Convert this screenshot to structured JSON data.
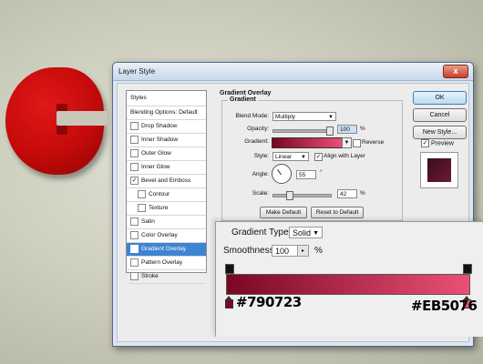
{
  "window": {
    "title": "Layer Style",
    "close_symbol": "x"
  },
  "styles_list": {
    "header": "Styles",
    "items": [
      {
        "label": "Blending Options: Default",
        "checkbox": false,
        "checked": false,
        "indent": false,
        "selected": false
      },
      {
        "label": "Drop Shadow",
        "checkbox": true,
        "checked": false,
        "indent": false,
        "selected": false
      },
      {
        "label": "Inner Shadow",
        "checkbox": true,
        "checked": false,
        "indent": false,
        "selected": false
      },
      {
        "label": "Outer Glow",
        "checkbox": true,
        "checked": false,
        "indent": false,
        "selected": false
      },
      {
        "label": "Inner Glow",
        "checkbox": true,
        "checked": false,
        "indent": false,
        "selected": false
      },
      {
        "label": "Bevel and Emboss",
        "checkbox": true,
        "checked": true,
        "indent": false,
        "selected": false
      },
      {
        "label": "Contour",
        "checkbox": true,
        "checked": false,
        "indent": true,
        "selected": false
      },
      {
        "label": "Texture",
        "checkbox": true,
        "checked": false,
        "indent": true,
        "selected": false
      },
      {
        "label": "Satin",
        "checkbox": true,
        "checked": false,
        "indent": false,
        "selected": false
      },
      {
        "label": "Color Overlay",
        "checkbox": true,
        "checked": false,
        "indent": false,
        "selected": false
      },
      {
        "label": "Gradient Overlay",
        "checkbox": true,
        "checked": true,
        "indent": false,
        "selected": true
      },
      {
        "label": "Pattern Overlay",
        "checkbox": true,
        "checked": false,
        "indent": false,
        "selected": false
      },
      {
        "label": "Stroke",
        "checkbox": true,
        "checked": false,
        "indent": false,
        "selected": false
      }
    ]
  },
  "buttons": {
    "ok": "OK",
    "cancel": "Cancel",
    "new_style": "New Style...",
    "preview": "Preview",
    "preview_checked": true
  },
  "gradient_overlay": {
    "panel_title": "Gradient Overlay",
    "group_title": "Gradient",
    "blend_mode_label": "Blend Mode:",
    "blend_mode_value": "Multiply",
    "opacity_label": "Opacity:",
    "opacity_value": "100",
    "opacity_unit": "%",
    "gradient_label": "Gradient:",
    "reverse_label": "Reverse",
    "reverse_checked": false,
    "style_label": "Style:",
    "style_value": "Linear",
    "align_label": "Align with Layer",
    "align_checked": true,
    "angle_label": "Angle:",
    "angle_value": "55",
    "angle_unit": "°",
    "scale_label": "Scale:",
    "scale_value": "42",
    "scale_unit": "%",
    "make_default": "Make Default",
    "reset_default": "Reset to Default"
  },
  "gradient_editor": {
    "type_label": "Gradient Type:",
    "type_value": "Solid",
    "smoothness_label": "Smoothness:",
    "smoothness_value": "100",
    "smoothness_unit": "%",
    "color_start": "#790723",
    "color_end": "#EB5076"
  },
  "colors": {
    "selection": "#3e84d2",
    "gradient_start": "#790723",
    "gradient_end": "#EB5076",
    "logo_red": "#d01010"
  }
}
